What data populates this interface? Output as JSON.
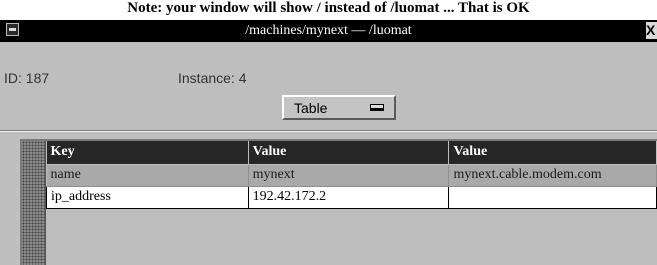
{
  "note": "Note: your window will show / instead of /luomat ... That is OK",
  "window": {
    "title": "/machines/mynext — /luomat",
    "close_glyph": "X"
  },
  "info": {
    "id_label": "ID: 187",
    "instance_label": "Instance: 4"
  },
  "view_menu": {
    "selected": "Table"
  },
  "table": {
    "headers": [
      "Key",
      "Value",
      "Value"
    ],
    "rows": [
      [
        "name",
        "mynext",
        "mynext.cable.modem.com"
      ],
      [
        "ip_address",
        "192.42.172.2",
        ""
      ]
    ]
  },
  "colors": {
    "titlebar": "#000000",
    "panel": "#bebebe",
    "header_row": "#262626",
    "dim_row": "#a9a9a9",
    "active_row": "#ffffff"
  }
}
